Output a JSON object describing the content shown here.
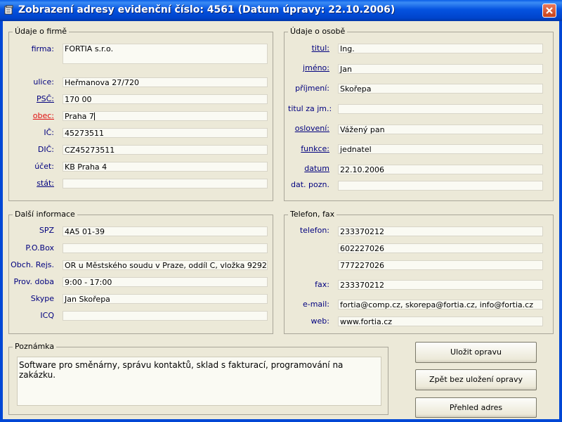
{
  "window": {
    "title": "Zobrazení adresy evidenční číslo: 4561  (Datum úpravy: 22.10.2006)"
  },
  "company": {
    "legend": "Údaje o firmě",
    "firma_label": "firma:",
    "firma_value": "FORTIA s.r.o.",
    "ulice_label": "ulice:",
    "ulice_value": "Heřmanova 27/720",
    "psc_label": "PSČ:",
    "psc_value": "170 00",
    "obec_label": "obec:",
    "obec_value": "Praha 7",
    "ic_label": "IČ:",
    "ic_value": "45273511",
    "dic_label": "DIČ:",
    "dic_value": "CZ45273511",
    "ucet_label": "účet:",
    "ucet_value": "KB Praha 4",
    "stat_label": "stát:",
    "stat_value": ""
  },
  "person": {
    "legend": "Údaje o osobě",
    "titul_label": "titul:",
    "titul_value": "Ing.",
    "jmeno_label": "jméno:",
    "jmeno_value": "Jan",
    "prijmeni_label": "příjmení:",
    "prijmeni_value": "Skořepa",
    "titul_za_label": "titul za jm.:",
    "titul_za_value": "",
    "osloveni_label": "oslovení:",
    "osloveni_value": "Vážený pan",
    "funkce_label": "funkce:",
    "funkce_value": "jednatel",
    "datum_label": "datum",
    "datum_value": "22.10.2006",
    "dat_pozn_label": "dat. pozn.",
    "dat_pozn_value": ""
  },
  "other": {
    "legend": "Další informace",
    "spz_label": "SPZ",
    "spz_value": "4A5 01-39",
    "pobox_label": "P.O.Box",
    "pobox_value": "",
    "obch_label": "Obch. Rejs.",
    "obch_value": "OR u Městského soudu v Praze, oddíl C, vložka 9292",
    "prov_label": "Prov. doba",
    "prov_value": "9:00 - 17:00",
    "skype_label": "Skype",
    "skype_value": "Jan Skořepa",
    "icq_label": "ICQ",
    "icq_value": ""
  },
  "phone": {
    "legend": "Telefon, fax",
    "telefon_label": "telefon:",
    "telefon_values": [
      "233370212",
      "602227026",
      "777227026"
    ],
    "fax_label": "fax:",
    "fax_value": "233370212",
    "email_label": "e-mail:",
    "email_value": "fortia@comp.cz, skorepa@fortia.cz, info@fortia.cz",
    "web_label": "web:",
    "web_value": "www.fortia.cz"
  },
  "note": {
    "legend": "Poznámka",
    "text": "Software pro směnárny, správu kontaktů, sklad s fakturací, programování na zakázku."
  },
  "buttons": {
    "save": "Uložit opravu",
    "back": "Zpět bez uložení opravy",
    "overview": "Přehled adres"
  },
  "colors": {
    "titlebar": "#0054e3",
    "background": "#ece9d8",
    "label": "#00007f",
    "required_label": "#e01010"
  },
  "icons": {
    "window": "window-app-icon",
    "close": "close-icon"
  }
}
